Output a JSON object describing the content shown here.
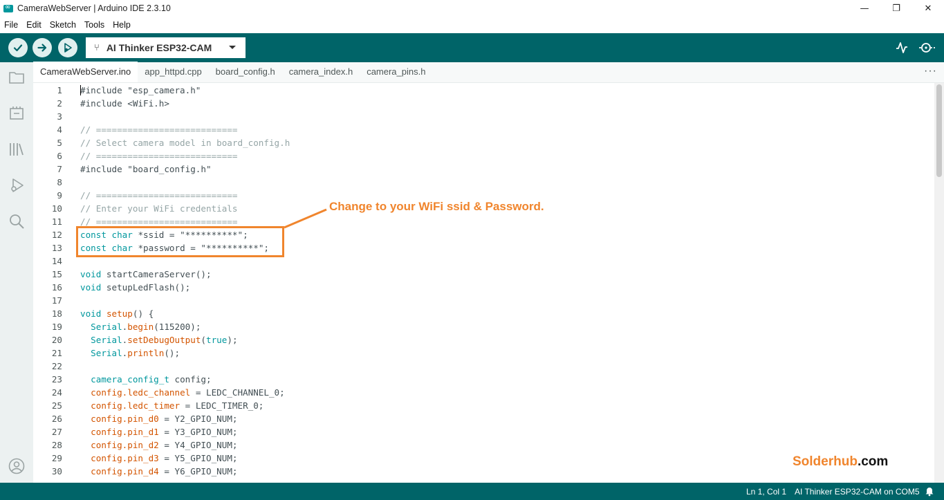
{
  "window": {
    "title": "CameraWebServer | Arduino IDE 2.3.10",
    "controls": {
      "minimize": "—",
      "maximize": "❐",
      "close": "✕"
    }
  },
  "menu": {
    "items": [
      "File",
      "Edit",
      "Sketch",
      "Tools",
      "Help"
    ]
  },
  "toolbar": {
    "board": "AI Thinker ESP32-CAM",
    "icons": [
      "verify-icon",
      "upload-icon",
      "debug-icon",
      "serial-plotter-icon",
      "serial-monitor-icon"
    ]
  },
  "sidebar": {
    "icons": [
      "folder-icon",
      "boards-manager-icon",
      "library-icon",
      "debug-icon",
      "search-icon",
      "account-icon"
    ]
  },
  "tabs": {
    "items": [
      "CameraWebServer.ino",
      "app_httpd.cpp",
      "board_config.h",
      "camera_index.h",
      "camera_pins.h"
    ],
    "active": 0,
    "more": "···"
  },
  "code": {
    "lines": [
      {
        "n": "1",
        "parts": [
          [
            "p",
            "#include \"esp_camera.h\""
          ]
        ]
      },
      {
        "n": "2",
        "parts": [
          [
            "p",
            "#include <WiFi.h>"
          ]
        ]
      },
      {
        "n": "3",
        "parts": []
      },
      {
        "n": "4",
        "parts": [
          [
            "c",
            "// ==========================="
          ]
        ]
      },
      {
        "n": "5",
        "parts": [
          [
            "c",
            "// Select camera model in board_config.h"
          ]
        ]
      },
      {
        "n": "6",
        "parts": [
          [
            "c",
            "// ==========================="
          ]
        ]
      },
      {
        "n": "7",
        "parts": [
          [
            "p",
            "#include \"board_config.h\""
          ]
        ]
      },
      {
        "n": "8",
        "parts": []
      },
      {
        "n": "9",
        "parts": [
          [
            "c",
            "// ==========================="
          ]
        ]
      },
      {
        "n": "10",
        "parts": [
          [
            "c",
            "// Enter your WiFi credentials"
          ]
        ]
      },
      {
        "n": "11",
        "parts": [
          [
            "c",
            "// ==========================="
          ]
        ]
      },
      {
        "n": "12",
        "parts": [
          [
            "k",
            "const"
          ],
          [
            "p",
            " "
          ],
          [
            "k",
            "char"
          ],
          [
            "p",
            " *ssid = \"**********\";"
          ]
        ]
      },
      {
        "n": "13",
        "parts": [
          [
            "k",
            "const"
          ],
          [
            "p",
            " "
          ],
          [
            "k",
            "char"
          ],
          [
            "p",
            " *password = \"**********\";"
          ]
        ]
      },
      {
        "n": "14",
        "parts": []
      },
      {
        "n": "15",
        "parts": [
          [
            "k",
            "void"
          ],
          [
            "p",
            " startCameraServer();"
          ]
        ]
      },
      {
        "n": "16",
        "parts": [
          [
            "k",
            "void"
          ],
          [
            "p",
            " setupLedFlash();"
          ]
        ]
      },
      {
        "n": "17",
        "parts": []
      },
      {
        "n": "18",
        "parts": [
          [
            "k",
            "void"
          ],
          [
            "p",
            " "
          ],
          [
            "f",
            "setup"
          ],
          [
            "p",
            "() {"
          ]
        ]
      },
      {
        "n": "19",
        "parts": [
          [
            "p",
            "  "
          ],
          [
            "k",
            "Serial"
          ],
          [
            "p",
            "."
          ],
          [
            "f",
            "begin"
          ],
          [
            "p",
            "(115200);"
          ]
        ]
      },
      {
        "n": "20",
        "parts": [
          [
            "p",
            "  "
          ],
          [
            "k",
            "Serial"
          ],
          [
            "p",
            "."
          ],
          [
            "f",
            "setDebugOutput"
          ],
          [
            "p",
            "("
          ],
          [
            "k",
            "true"
          ],
          [
            "p",
            ");"
          ]
        ]
      },
      {
        "n": "21",
        "parts": [
          [
            "p",
            "  "
          ],
          [
            "k",
            "Serial"
          ],
          [
            "p",
            "."
          ],
          [
            "f",
            "println"
          ],
          [
            "p",
            "();"
          ]
        ]
      },
      {
        "n": "22",
        "parts": []
      },
      {
        "n": "23",
        "parts": [
          [
            "p",
            "  "
          ],
          [
            "k",
            "camera_config_t"
          ],
          [
            "p",
            " config;"
          ]
        ]
      },
      {
        "n": "24",
        "parts": [
          [
            "p",
            "  "
          ],
          [
            "f",
            "config.ledc_channel"
          ],
          [
            "p",
            " = LEDC_CHANNEL_0;"
          ]
        ]
      },
      {
        "n": "25",
        "parts": [
          [
            "p",
            "  "
          ],
          [
            "f",
            "config.ledc_timer"
          ],
          [
            "p",
            " = LEDC_TIMER_0;"
          ]
        ]
      },
      {
        "n": "26",
        "parts": [
          [
            "p",
            "  "
          ],
          [
            "f",
            "config.pin_d0"
          ],
          [
            "p",
            " = Y2_GPIO_NUM;"
          ]
        ]
      },
      {
        "n": "27",
        "parts": [
          [
            "p",
            "  "
          ],
          [
            "f",
            "config.pin_d1"
          ],
          [
            "p",
            " = Y3_GPIO_NUM;"
          ]
        ]
      },
      {
        "n": "28",
        "parts": [
          [
            "p",
            "  "
          ],
          [
            "f",
            "config.pin_d2"
          ],
          [
            "p",
            " = Y4_GPIO_NUM;"
          ]
        ]
      },
      {
        "n": "29",
        "parts": [
          [
            "p",
            "  "
          ],
          [
            "f",
            "config.pin_d3"
          ],
          [
            "p",
            " = Y5_GPIO_NUM;"
          ]
        ]
      },
      {
        "n": "30",
        "parts": [
          [
            "p",
            "  "
          ],
          [
            "f",
            "config.pin_d4"
          ],
          [
            "p",
            " = Y6_GPIO_NUM;"
          ]
        ]
      }
    ]
  },
  "annotation": {
    "text": "Change to your WiFi ssid & Password."
  },
  "watermark": {
    "part1": "Solder",
    "part2": "hub",
    "part3": ".com"
  },
  "status": {
    "position": "Ln 1, Col 1",
    "board": "AI Thinker ESP32-CAM on COM5"
  },
  "colors": {
    "teal": "#006468",
    "accent": "#f0852d",
    "keyword": "#00979d",
    "function": "#d35400",
    "comment": "#95a5a6"
  }
}
